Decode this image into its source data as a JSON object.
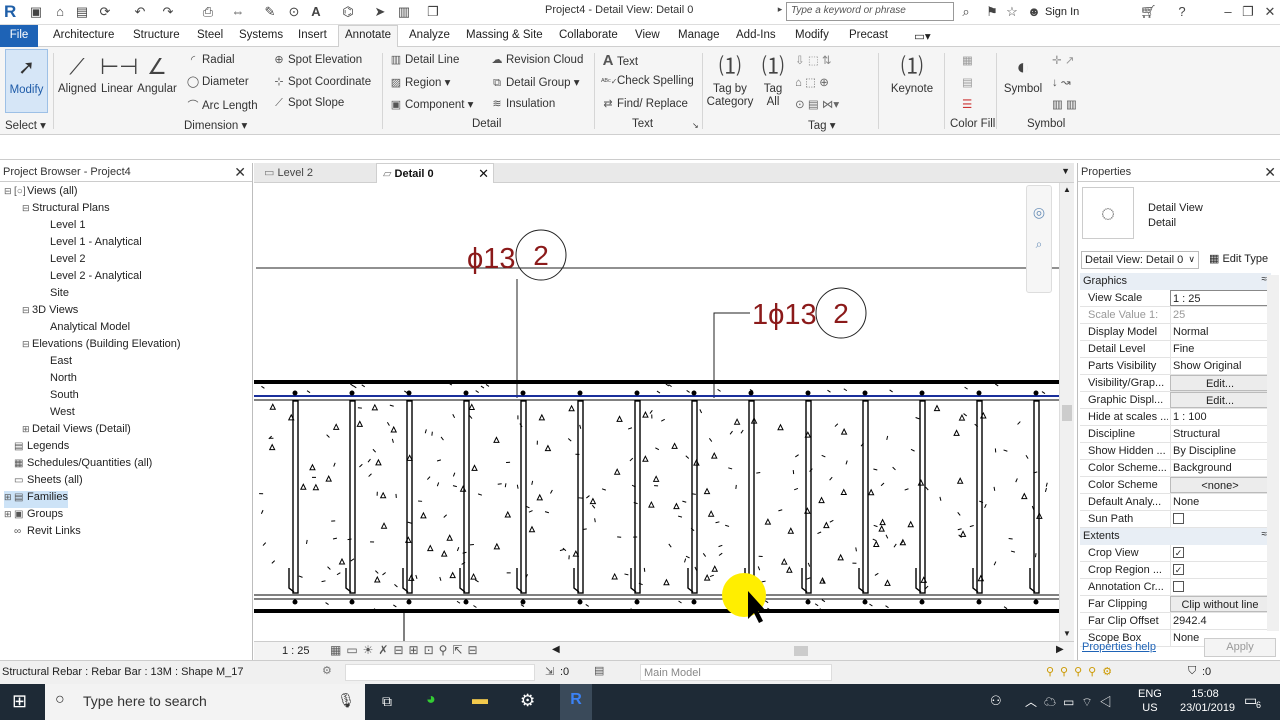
{
  "app": {
    "logo": "R",
    "title": "Project4 - Detail View: Detail 0",
    "search_placeholder": "Type a keyword or phrase",
    "signin": "Sign In"
  },
  "tabs": [
    "File",
    "Architecture",
    "Structure",
    "Steel",
    "Systems",
    "Insert",
    "Annotate",
    "Analyze",
    "Massing & Site",
    "Collaborate",
    "View",
    "Manage",
    "Add-Ins",
    "Modify",
    "Precast"
  ],
  "active_tab": "Annotate",
  "ribbon": {
    "modify": "Modify",
    "select": "Select ▾",
    "aligned": "Aligned",
    "linear": "Linear",
    "angular": "Angular",
    "radial": "Radial",
    "diameter": "Diameter",
    "arc_length": "Arc Length",
    "spot_elevation": "Spot Elevation",
    "spot_coordinate": "Spot Coordinate",
    "spot_slope": "Spot Slope",
    "dimension": "Dimension ▾",
    "detail_line": "Detail Line",
    "region": "Region ▾",
    "component": "Component ▾",
    "revision_cloud": "Revision Cloud",
    "detail_group": "Detail Group ▾",
    "insulation": "Insulation",
    "detail": "Detail",
    "text": "Text",
    "check_spelling": "Check Spelling",
    "find_replace": "Find/ Replace",
    "text_panel": "Text",
    "tag_by_category": "Tag by\nCategory",
    "tag_all": "Tag\nAll",
    "tag_panel": "Tag ▾",
    "keynote": "Keynote",
    "color_fill": "Color Fill",
    "symbol": "Symbol",
    "symbol_panel": "Symbol"
  },
  "project_browser": {
    "header": "Project Browser - Project4",
    "items": [
      {
        "label": "Views (all)",
        "level": 0,
        "toggle": "⊟",
        "icon": "[○]"
      },
      {
        "label": "Structural Plans",
        "level": 1,
        "toggle": "⊟",
        "icon": ""
      },
      {
        "label": "Level 1",
        "level": 2,
        "toggle": "",
        "icon": ""
      },
      {
        "label": "Level 1 - Analytical",
        "level": 2,
        "toggle": "",
        "icon": ""
      },
      {
        "label": "Level 2",
        "level": 2,
        "toggle": "",
        "icon": ""
      },
      {
        "label": "Level 2 - Analytical",
        "level": 2,
        "toggle": "",
        "icon": ""
      },
      {
        "label": "Site",
        "level": 2,
        "toggle": "",
        "icon": ""
      },
      {
        "label": "3D Views",
        "level": 1,
        "toggle": "⊟",
        "icon": ""
      },
      {
        "label": "Analytical Model",
        "level": 2,
        "toggle": "",
        "icon": ""
      },
      {
        "label": "Elevations (Building Elevation)",
        "level": 1,
        "toggle": "⊟",
        "icon": ""
      },
      {
        "label": "East",
        "level": 2,
        "toggle": "",
        "icon": ""
      },
      {
        "label": "North",
        "level": 2,
        "toggle": "",
        "icon": ""
      },
      {
        "label": "South",
        "level": 2,
        "toggle": "",
        "icon": ""
      },
      {
        "label": "West",
        "level": 2,
        "toggle": "",
        "icon": ""
      },
      {
        "label": "Detail Views (Detail)",
        "level": 1,
        "toggle": "⊞",
        "icon": ""
      },
      {
        "label": "Legends",
        "level": 0,
        "toggle": "",
        "icon": "▤"
      },
      {
        "label": "Schedules/Quantities (all)",
        "level": 0,
        "toggle": "",
        "icon": "▦"
      },
      {
        "label": "Sheets (all)",
        "level": 0,
        "toggle": "",
        "icon": "▭"
      },
      {
        "label": "Families",
        "level": 0,
        "toggle": "⊞",
        "icon": "▤",
        "selected": true
      },
      {
        "label": "Groups",
        "level": 0,
        "toggle": "⊞",
        "icon": "▣"
      },
      {
        "label": "Revit Links",
        "level": 0,
        "toggle": "",
        "icon": "∞"
      }
    ]
  },
  "view_tabs": [
    {
      "label": "Level 2",
      "active": false
    },
    {
      "label": "Detail 0",
      "active": true
    }
  ],
  "drawing": {
    "tag1_text": "ϕ13",
    "tag1_num": "2",
    "tag2_text": "1ϕ13",
    "tag2_num": "2",
    "annotation_color": "#8b1a1a"
  },
  "viewbar": {
    "scale": "1 : 25"
  },
  "properties": {
    "header": "Properties",
    "type_name": "Detail View",
    "type_sub": "Detail",
    "instance": "Detail View: Detail 0",
    "edit_type": "Edit Type",
    "sections": [
      {
        "title": "Graphics",
        "rows": [
          {
            "k": "View Scale",
            "v": "1 : 25",
            "style": "input"
          },
          {
            "k": "Scale Value    1:",
            "v": "25",
            "style": "dim"
          },
          {
            "k": "Display Model",
            "v": "Normal"
          },
          {
            "k": "Detail Level",
            "v": "Fine"
          },
          {
            "k": "Parts Visibility",
            "v": "Show Original"
          },
          {
            "k": "Visibility/Grap...",
            "v": "Edit...",
            "style": "btn"
          },
          {
            "k": "Graphic Displ...",
            "v": "Edit...",
            "style": "btn"
          },
          {
            "k": "Hide at scales ...",
            "v": "1 : 100"
          },
          {
            "k": "Discipline",
            "v": "Structural"
          },
          {
            "k": "Show Hidden ...",
            "v": "By Discipline"
          },
          {
            "k": "Color Scheme...",
            "v": "Background"
          },
          {
            "k": "Color Scheme",
            "v": "<none>",
            "style": "btn"
          },
          {
            "k": "Default Analy...",
            "v": "None"
          },
          {
            "k": "Sun Path",
            "v": "",
            "style": "check",
            "checked": false
          }
        ]
      },
      {
        "title": "Extents",
        "rows": [
          {
            "k": "Crop View",
            "v": "",
            "style": "check",
            "checked": true
          },
          {
            "k": "Crop Region ...",
            "v": "",
            "style": "check",
            "checked": true
          },
          {
            "k": "Annotation Cr...",
            "v": "",
            "style": "check",
            "checked": false
          },
          {
            "k": "Far Clipping",
            "v": "Clip without line",
            "style": "btn"
          },
          {
            "k": "Far Clip Offset",
            "v": "2942.4"
          },
          {
            "k": "Scope Box",
            "v": "None"
          }
        ]
      }
    ],
    "help": "Properties help",
    "apply": "Apply"
  },
  "status": {
    "text": "Structural Rebar : Rebar Bar : 13M : Shape M_17",
    "count": ":0",
    "workset": "Main Model",
    "filter": ":0"
  },
  "taskbar": {
    "search": "Type here to search",
    "lang": "ENG",
    "region": "US",
    "time": "15:08",
    "date": "23/01/2019",
    "notif": "6"
  }
}
